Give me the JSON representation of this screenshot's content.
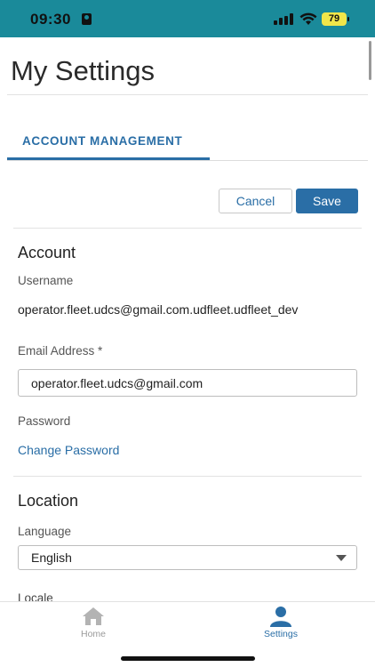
{
  "status_bar": {
    "time": "09:30",
    "battery": "79",
    "background": "#1a8a9a"
  },
  "header": {
    "title": "My Settings"
  },
  "tabs": [
    {
      "label": "ACCOUNT MANAGEMENT",
      "active": true
    }
  ],
  "actions": {
    "cancel_label": "Cancel",
    "save_label": "Save"
  },
  "account": {
    "section_title": "Account",
    "username_label": "Username",
    "username_value": "operator.fleet.udcs@gmail.com.udfleet.udfleet_dev",
    "email_label": "Email Address *",
    "email_value": "operator.fleet.udcs@gmail.com",
    "password_label": "Password",
    "change_password_link": "Change Password"
  },
  "location": {
    "section_title": "Location",
    "language_label": "Language",
    "language_value": "English",
    "locale_label": "Locale"
  },
  "bottom_nav": {
    "items": [
      {
        "label": "Home",
        "icon": "home-icon",
        "active": false
      },
      {
        "label": "Settings",
        "icon": "user-icon",
        "active": true
      }
    ]
  },
  "colors": {
    "accent": "#2a6ea6",
    "inactive": "#9a9a9a"
  }
}
